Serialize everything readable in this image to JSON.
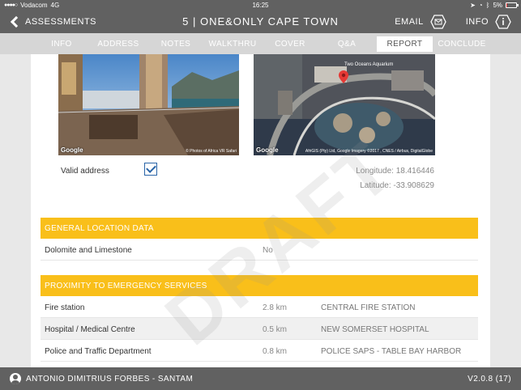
{
  "status_bar": {
    "signal_dots": "●●●●○",
    "carrier": "Vodacom",
    "network": "4G",
    "time": "16:25",
    "battery_percent": "5%",
    "battery_level": 0.05
  },
  "nav": {
    "back_label": "ASSESSMENTS",
    "title": "5 | ONE&ONLY CAPE TOWN",
    "email_label": "EMAIL",
    "info_label": "INFO"
  },
  "tabs": [
    {
      "label": "INFO",
      "active": false
    },
    {
      "label": "ADDRESS",
      "active": false
    },
    {
      "label": "NOTES",
      "active": false
    },
    {
      "label": "WALKTHRU",
      "active": false
    },
    {
      "label": "COVER",
      "active": false
    },
    {
      "label": "Q&A",
      "active": false
    },
    {
      "label": "REPORT",
      "active": true
    },
    {
      "label": "CONCLUDE",
      "active": false
    }
  ],
  "images": {
    "photo_logo": "Google",
    "photo_credit": "© Photos of Africa VR Safari",
    "map_logo": "Google",
    "map_credit": "AfriGIS (Pty) Ltd, Google Imagery ©2017 , CNES / Airbus, DigitalGlobe",
    "map_label": "Two Oceans Aquarium"
  },
  "address": {
    "valid_label": "Valid address",
    "valid_checked": true,
    "longitude": "Longitude: 18.416446",
    "latitude": "Latitude: -33.908629"
  },
  "general_location": {
    "header": "GENERAL LOCATION DATA",
    "rows": [
      {
        "name": "Dolomite and Limestone",
        "value": "No"
      }
    ]
  },
  "proximity": {
    "header": "PROXIMITY TO EMERGENCY SERVICES",
    "rows": [
      {
        "name": "Fire station",
        "distance": "2.8 km",
        "place": "CENTRAL FIRE STATION"
      },
      {
        "name": "Hospital / Medical Centre",
        "distance": "0.5 km",
        "place": "NEW SOMERSET HOSPITAL"
      },
      {
        "name": "Police and Traffic Department",
        "distance": "0.8 km",
        "place": "POLICE SAPS - TABLE BAY HARBOR"
      }
    ]
  },
  "watermark": "DRAFT",
  "footer": {
    "user": "ANTONIO DIMITRIUS FORBES - SANTAM",
    "version": "V2.0.8 (17)"
  },
  "colors": {
    "bar_gray": "#616161",
    "tab_gray": "#d6d6d6",
    "section_yellow": "#f9bf1a",
    "check_blue": "#2a65a8"
  }
}
